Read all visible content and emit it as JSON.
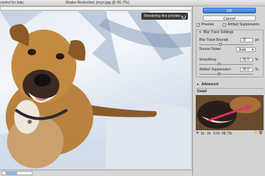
{
  "window": {
    "title": "Shake Reduction (myo.jpg @ 66.7%)",
    "help_text": "control for help."
  },
  "preview": {
    "status_badge": "Rendering fine preview ..."
  },
  "buttons": {
    "ok": "OK",
    "cancel": "Cancel"
  },
  "options": {
    "preview_label": "Preview",
    "preview_checked": true,
    "artifact_suppression_label": "Artifact Suppression",
    "artifact_suppression_checked": true
  },
  "blur_trace": {
    "group_label": "Blur Trace Settings",
    "bounds_label": "Blur Trace Bounds",
    "bounds_value": "32",
    "bounds_unit": "px",
    "source_noise_label": "Source Noise:",
    "source_noise_value": "Auto",
    "smoothing_label": "Smoothing",
    "smoothing_value": "30.0",
    "smoothing_unit": "%",
    "artifact_label": "Artifact Suppression",
    "artifact_value": "30.0",
    "artifact_unit": "%"
  },
  "advanced": {
    "label": "Advanced"
  },
  "detail": {
    "label": "Detail",
    "zoom_options": [
      "1x",
      "2x",
      "0.5x"
    ],
    "zoom_readout": "66.7%"
  },
  "colors": {
    "accent_button": "#2f74d9",
    "blur_trace_arrow": "#e0326a"
  }
}
